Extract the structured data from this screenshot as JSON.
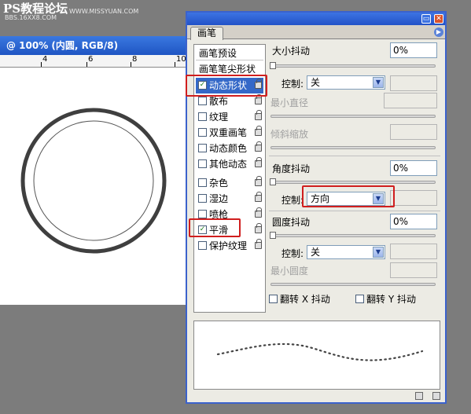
{
  "watermark": {
    "line1": "PS教程论坛",
    "line2": "WWW.MISSYUAN.COM",
    "line3": "BBS.16XX8.COM"
  },
  "document": {
    "title": "@ 100% (内圆, RGB/8)",
    "ruler_labels": [
      "4",
      "6",
      "8",
      "10"
    ]
  },
  "palette": {
    "tab": "画笔",
    "left": {
      "header1": "画笔预设",
      "header2": "画笔笔尖形状",
      "items": [
        {
          "label": "动态形状",
          "checked": true,
          "selected": true
        },
        {
          "label": "散布",
          "checked": false
        },
        {
          "label": "纹理",
          "checked": false
        },
        {
          "label": "双重画笔",
          "checked": false
        },
        {
          "label": "动态颜色",
          "checked": false
        },
        {
          "label": "其他动态",
          "checked": false
        },
        {
          "label": "杂色",
          "checked": false
        },
        {
          "label": "湿边",
          "checked": false
        },
        {
          "label": "喷枪",
          "checked": false
        },
        {
          "label": "平滑",
          "checked": true
        },
        {
          "label": "保护纹理",
          "checked": false
        }
      ]
    },
    "right": {
      "size_jitter_label": "大小抖动",
      "size_jitter_value": "0%",
      "control_label": "控制:",
      "size_control_value": "关",
      "min_diameter_label": "最小直径",
      "tilt_scale_label": "倾斜缩放",
      "angle_jitter_label": "角度抖动",
      "angle_jitter_value": "0%",
      "angle_control_value": "方向",
      "roundness_jitter_label": "圆度抖动",
      "roundness_jitter_value": "0%",
      "roundness_control_value": "关",
      "min_roundness_label": "最小圆度",
      "flip_x_label": "翻转 X 抖动",
      "flip_y_label": "翻转 Y 抖动"
    }
  }
}
